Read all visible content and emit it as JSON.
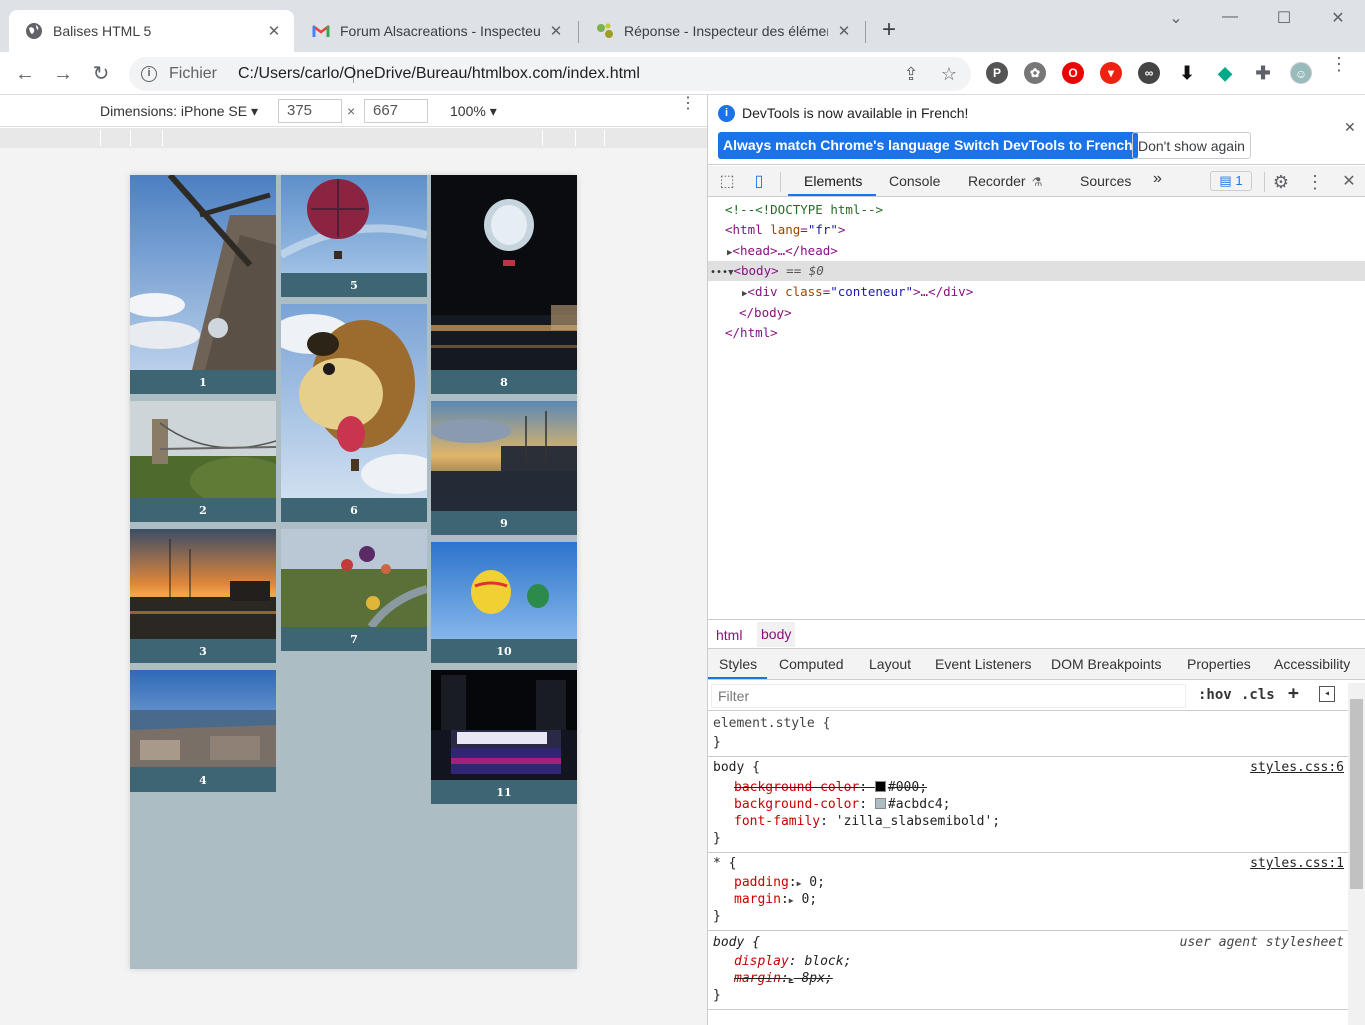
{
  "browser": {
    "tabs": [
      {
        "title": "Balises HTML 5",
        "icon": "globe-icon",
        "active": true
      },
      {
        "title": "Forum Alsacreations - Inspecteur",
        "icon": "gmail-icon",
        "active": false
      },
      {
        "title": "Réponse - Inspecteur des élémen",
        "icon": "site-icon",
        "active": false
      }
    ],
    "omnibox": {
      "protocol_label": "Fichier",
      "url": "C:/Users/carlo/OneDrive/Bureau/htmlbox.com/index.html"
    }
  },
  "device_toolbar": {
    "dimensions_label": "Dimensions: iPhone SE ▾",
    "width": "375",
    "times": "×",
    "height": "667",
    "zoom": "100% ▾"
  },
  "page": {
    "background": "#acbdc4",
    "caption_color": "#3d6574",
    "cards": [
      {
        "caption": "1",
        "image": "windmill"
      },
      {
        "caption": "2",
        "image": "suspension-bridge"
      },
      {
        "caption": "3",
        "image": "harbor-sunset"
      },
      {
        "caption": "4",
        "image": "city-view"
      },
      {
        "caption": "5",
        "image": "hot-air-balloon"
      },
      {
        "caption": "6",
        "image": "dog-balloon"
      },
      {
        "caption": "7",
        "image": "balloons-landscape"
      },
      {
        "caption": "8",
        "image": "night-balloon"
      },
      {
        "caption": "9",
        "image": "harbor-evening"
      },
      {
        "caption": "10",
        "image": "yellow-balloon"
      },
      {
        "caption": "11",
        "image": "toronto-sign"
      }
    ]
  },
  "devtools": {
    "infobar": {
      "message": "DevTools is now available in French!",
      "btn_match": "Always match Chrome's language",
      "btn_switch": "Switch DevTools to French",
      "btn_dismiss": "Don't show again"
    },
    "tabs": {
      "elements": "Elements",
      "console": "Console",
      "recorder": "Recorder",
      "sources": "Sources",
      "more": "»",
      "issues": "1"
    },
    "dom": {
      "comment": "<!--<!DOCTYPE html-->",
      "html_open_tag": "<html",
      "html_lang_attr": "lang",
      "html_lang_val": "\"fr\"",
      "gt": ">",
      "head": "<head>…</head>",
      "body_open": "<body>",
      "body_eq": "== $0",
      "div_open": "<div",
      "div_class_attr": "class",
      "div_class_val": "\"conteneur\"",
      "div_rest": ">…</div>",
      "body_close": "</body>",
      "html_close": "</html>",
      "dots": "•••"
    },
    "breadcrumbs": [
      "html",
      "body"
    ],
    "subtabs": [
      "Styles",
      "Computed",
      "Layout",
      "Event Listeners",
      "DOM Breakpoints",
      "Properties",
      "Accessibility"
    ],
    "filter": {
      "placeholder": "Filter",
      "hov": ":hov",
      "cls": ".cls",
      "plus": "+"
    },
    "styles": {
      "element_style": "element.style {",
      "close": "}",
      "rule1_sel": "body {",
      "rule1_src": "styles.css:6",
      "r1p1_name": "background-color",
      "r1p1_val": "#000;",
      "r1p1_swatch": "#000000",
      "r1p2_name": "background-color",
      "r1p2_val": "#acbdc4;",
      "r1p2_swatch": "#acbdc4",
      "r1p3_name": "font-family",
      "r1p3_val": "'zilla_slabsemibold';",
      "rule2_sel": "* {",
      "rule2_src": "styles.css:1",
      "r2p1_name": "padding",
      "r2p1_val": "0;",
      "r2p2_name": "margin",
      "r2p2_val": "0;",
      "rule3_sel": "body {",
      "rule3_src": "user agent stylesheet",
      "r3p1_name": "display",
      "r3p1_val": "block;",
      "r3p2_name": "margin",
      "r3p2_val": "8px;",
      "colon": ":",
      "arrow": "▶"
    }
  },
  "extensions": [
    "pinterest-icon",
    "film-icon",
    "opera-icon",
    "shield-icon",
    "binoculars-icon",
    "download-icon",
    "feedly-icon",
    "puzzle-icon",
    "avatar-icon"
  ]
}
